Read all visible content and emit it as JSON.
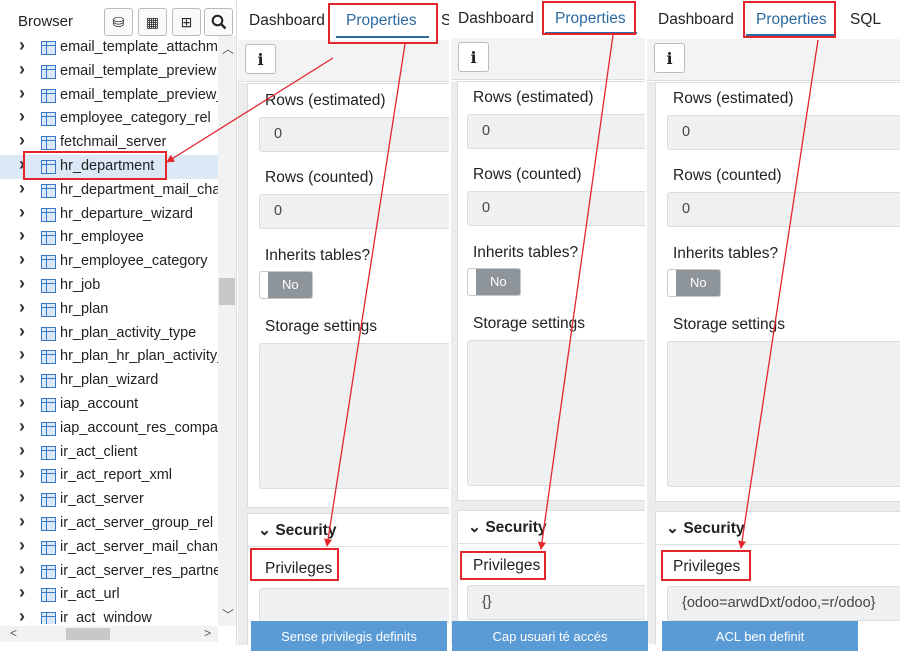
{
  "browser": {
    "title": "Browser",
    "toolbar": [
      {
        "icon": "database-icon",
        "glyph": "⛁"
      },
      {
        "icon": "table-icon",
        "glyph": "▦"
      },
      {
        "icon": "filtered-table-icon",
        "glyph": "⊞"
      },
      {
        "icon": "search-icon",
        "glyph": "🔍"
      }
    ],
    "items": [
      {
        "label": "email_template_attachm",
        "kind": "table"
      },
      {
        "label": "email_template_preview",
        "kind": "table"
      },
      {
        "label": "email_template_preview_",
        "kind": "table"
      },
      {
        "label": "employee_category_rel",
        "kind": "table"
      },
      {
        "label": "fetchmail_server",
        "kind": "table"
      },
      {
        "label": "hr_department",
        "kind": "table",
        "selected": true
      },
      {
        "label": "hr_department_mail_cha",
        "kind": "table"
      },
      {
        "label": "hr_departure_wizard",
        "kind": "table"
      },
      {
        "label": "hr_employee",
        "kind": "table"
      },
      {
        "label": "hr_employee_category",
        "kind": "table"
      },
      {
        "label": "hr_job",
        "kind": "table"
      },
      {
        "label": "hr_plan",
        "kind": "table"
      },
      {
        "label": "hr_plan_activity_type",
        "kind": "table"
      },
      {
        "label": "hr_plan_hr_plan_activity_",
        "kind": "table"
      },
      {
        "label": "hr_plan_wizard",
        "kind": "table"
      },
      {
        "label": "iap_account",
        "kind": "table"
      },
      {
        "label": "iap_account_res_compar",
        "kind": "table"
      },
      {
        "label": "ir_act_client",
        "kind": "inherited"
      },
      {
        "label": "ir_act_report_xml",
        "kind": "inherited"
      },
      {
        "label": "ir_act_server",
        "kind": "inherited"
      },
      {
        "label": "ir_act_server_group_rel",
        "kind": "table"
      },
      {
        "label": "ir_act_server_mail_chann",
        "kind": "table"
      },
      {
        "label": "ir_act_server_res_partne",
        "kind": "table"
      },
      {
        "label": "ir_act_url",
        "kind": "inherited"
      },
      {
        "label": "ir_act_window",
        "kind": "inherited"
      }
    ]
  },
  "panels": [
    {
      "tabs": [
        "Dashboard",
        "Properties",
        "S"
      ],
      "info_icon": "i",
      "rows_estimated_label": "Rows (estimated)",
      "rows_estimated_value": "0",
      "rows_counted_label": "Rows (counted)",
      "rows_counted_value": "0",
      "inherits_label": "Inherits tables?",
      "inherits_value": "No",
      "storage_label": "Storage settings",
      "security_label": "Security",
      "privileges_label": "Privileges",
      "privileges_value": "",
      "caption": "Sense privilegis definits"
    },
    {
      "tabs": [
        "Dashboard",
        "Properties"
      ],
      "info_icon": "i",
      "rows_estimated_label": "Rows (estimated)",
      "rows_estimated_value": "0",
      "rows_counted_label": "Rows (counted)",
      "rows_counted_value": "0",
      "inherits_label": "Inherits tables?",
      "inherits_value": "No",
      "storage_label": "Storage settings",
      "security_label": "Security",
      "privileges_label": "Privileges",
      "privileges_value": "{}",
      "caption": "Cap usuari té accés"
    },
    {
      "tabs": [
        "Dashboard",
        "Properties",
        "SQL"
      ],
      "info_icon": "i",
      "rows_estimated_label": "Rows (estimated)",
      "rows_estimated_value": "0",
      "rows_counted_label": "Rows (counted)",
      "rows_counted_value": "0",
      "inherits_label": "Inherits tables?",
      "inherits_value": "No",
      "storage_label": "Storage settings",
      "security_label": "Security",
      "privileges_label": "Privileges",
      "privileges_value": "{odoo=arwdDxt/odoo,=r/odoo}",
      "caption": "ACL ben definit"
    }
  ],
  "colors": {
    "accent": "#2c6aa0",
    "highlight": "#e3262b",
    "caption_bg": "#5b9bd5",
    "selection": "#dbe9f7"
  }
}
